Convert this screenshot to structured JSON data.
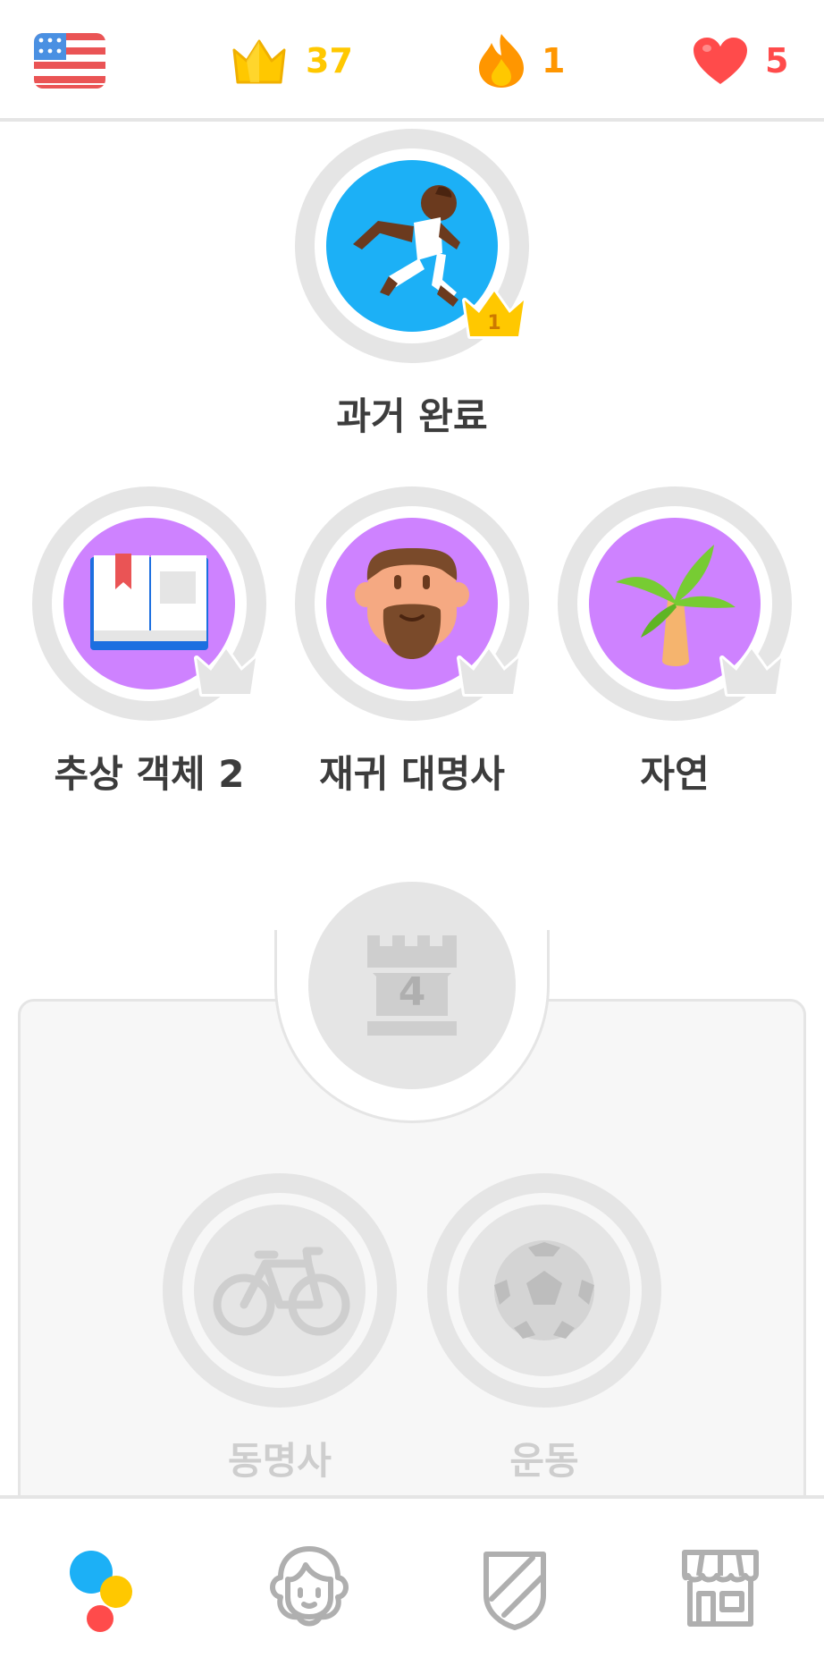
{
  "header": {
    "language_flag_icon": "us-flag-icon",
    "crowns": "37",
    "streak": "1",
    "hearts": "5",
    "colors": {
      "crown": "#ffc800",
      "streak": "#ff9600",
      "hearts": "#ff4b4b"
    }
  },
  "skills": [
    {
      "label": "과거 완료",
      "icon": "runner-icon",
      "level": "1",
      "color": "#1cb0f6",
      "state": "unlocked"
    },
    {
      "label": "추상 객체 2",
      "icon": "book-icon",
      "color": "#ce82ff",
      "state": "unlocked"
    },
    {
      "label": "재귀 대명사",
      "icon": "bearded-man-icon",
      "color": "#ce82ff",
      "state": "unlocked"
    },
    {
      "label": "자연",
      "icon": "palm-tree-icon",
      "color": "#ce82ff",
      "state": "unlocked"
    }
  ],
  "checkpoint": {
    "number": "4",
    "state": "locked"
  },
  "locked_skills": [
    {
      "label": "동명사",
      "icon": "bicycle-icon"
    },
    {
      "label": "운동",
      "icon": "soccer-ball-icon"
    }
  ],
  "nav": [
    {
      "name": "learn",
      "icon": "learn-dots-icon",
      "active": true
    },
    {
      "name": "profile",
      "icon": "profile-icon",
      "active": false
    },
    {
      "name": "leaderboard",
      "icon": "shield-icon",
      "active": false
    },
    {
      "name": "shop",
      "icon": "shop-icon",
      "active": false
    }
  ]
}
